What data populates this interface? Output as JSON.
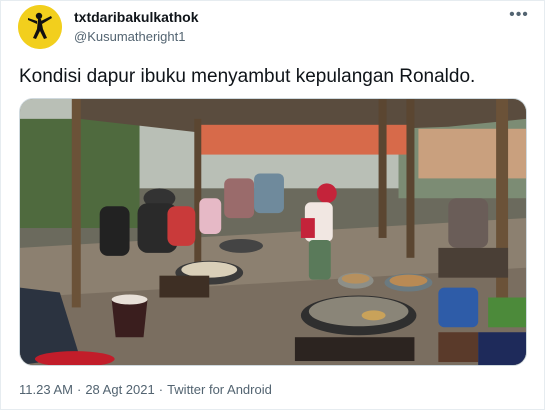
{
  "tweet": {
    "display_name": "txtdaribakulkathok",
    "handle": "@Kusumatheright1",
    "more_label": "•••",
    "text": "Kondisi dapur ibuku menyambut kepulangan Ronaldo.",
    "media": {
      "icon": "photo",
      "scene": "outdoor communal kitchen with women cooking in large woks over firewood"
    },
    "meta": {
      "time": "11.23 AM",
      "separator": "·",
      "date": "28 Agt 2021",
      "source": "Twitter for Android"
    }
  },
  "colors": {
    "avatar_bg": "#f2cf1d",
    "text_primary": "#0f1419",
    "text_secondary": "#536471",
    "border": "#cfd9de"
  }
}
